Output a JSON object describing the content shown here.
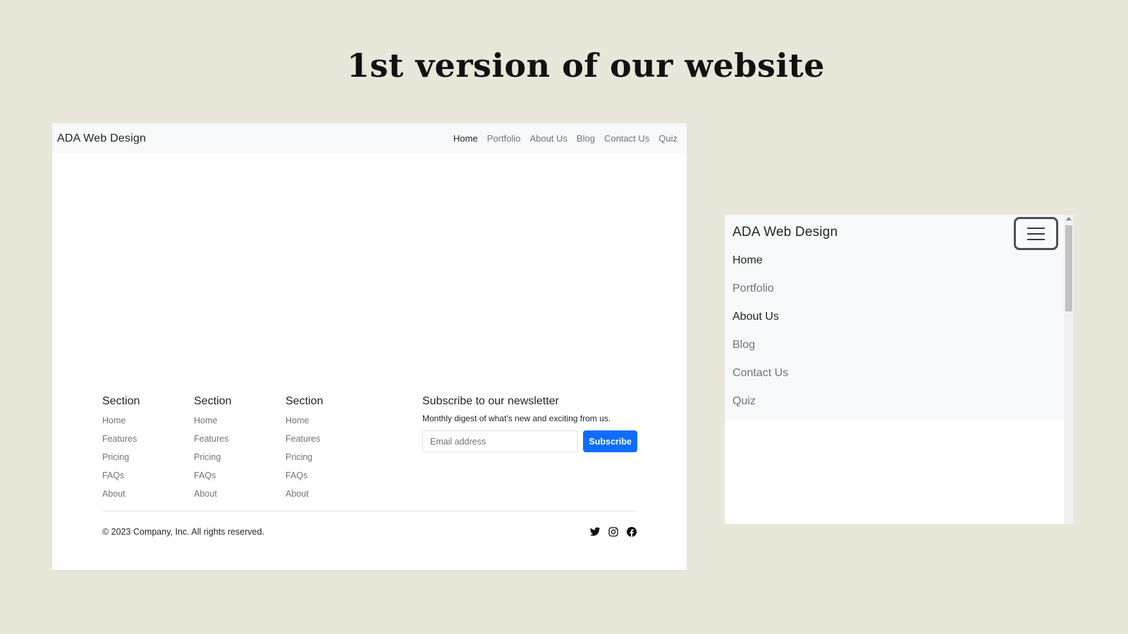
{
  "slide": {
    "title": "1st version of our website"
  },
  "desktop": {
    "nav": {
      "brand": "ADA Web Design",
      "links": [
        "Home",
        "Portfolio",
        "About Us",
        "Blog",
        "Contact Us",
        "Quiz"
      ],
      "active": "Home"
    },
    "footer": {
      "columns": [
        {
          "title": "Section",
          "items": [
            "Home",
            "Features",
            "Pricing",
            "FAQs",
            "About"
          ]
        },
        {
          "title": "Section",
          "items": [
            "Home",
            "Features",
            "Pricing",
            "FAQs",
            "About"
          ]
        },
        {
          "title": "Section",
          "items": [
            "Home",
            "Features",
            "Pricing",
            "FAQs",
            "About"
          ]
        }
      ],
      "newsletter": {
        "title": "Subscribe to our newsletter",
        "description": "Monthly digest of what's new and exciting from us.",
        "email_placeholder": "Email address",
        "button_label": "Subscribe"
      },
      "copyright": "© 2023 Company, Inc. All rights reserved.",
      "socials": [
        "twitter-icon",
        "instagram-icon",
        "facebook-icon"
      ]
    }
  },
  "mobile": {
    "brand": "ADA Web Design",
    "toggle_icon": "hamburger-menu-icon",
    "links": [
      "Home",
      "Portfolio",
      "About Us",
      "Blog",
      "Contact Us",
      "Quiz"
    ]
  },
  "colors": {
    "slide_background": "#e9e6da",
    "navbar_background": "#f8f9fa",
    "primary_button": "#0d6efd",
    "muted_text": "#6c757d"
  }
}
